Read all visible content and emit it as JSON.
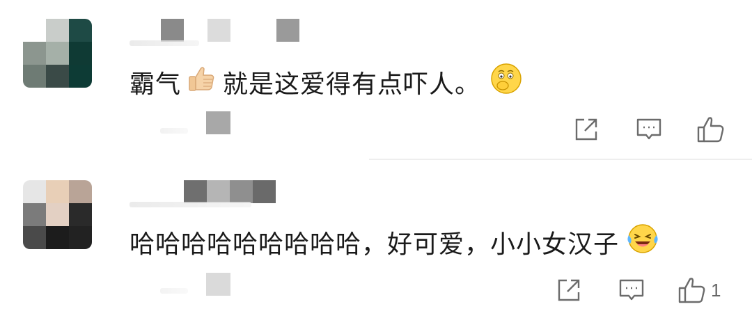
{
  "comments": [
    {
      "text": "霸气",
      "text2": "就是这爱得有点吓人。",
      "emoji_inline": "thumbs-up-icon",
      "emoji_end": "shy-face-icon",
      "like_count": ""
    },
    {
      "text": "哈哈哈哈哈哈哈哈哈，好可爱，小小女汉子",
      "emoji_end": "laughing-tears-icon",
      "like_count": "1"
    }
  ],
  "colors": {
    "text": "#1a1a1a",
    "icon": "#6b6b6b",
    "divider": "#eeeeee"
  }
}
